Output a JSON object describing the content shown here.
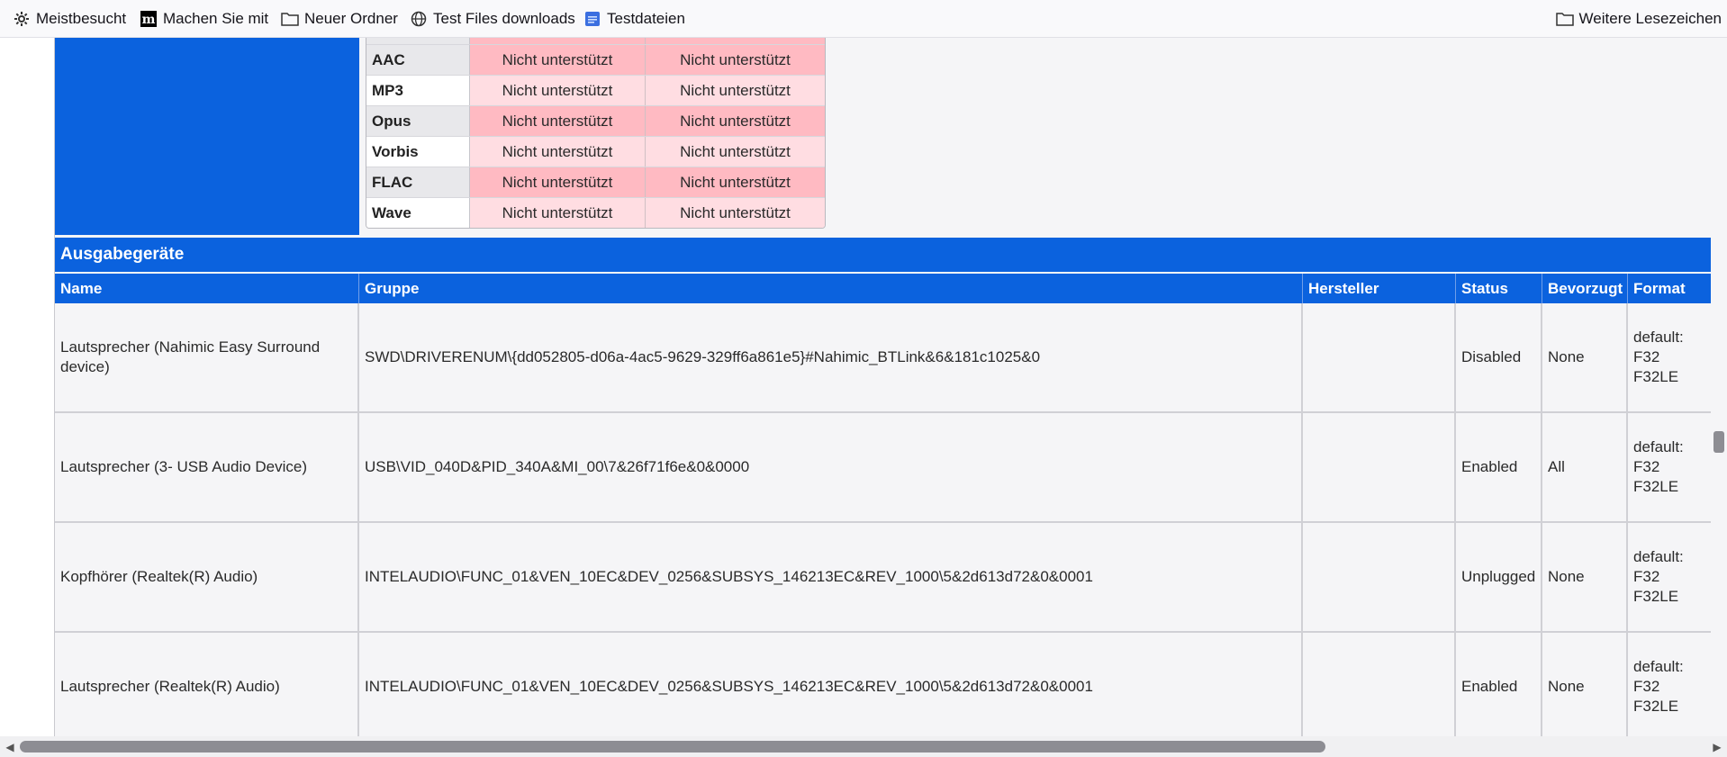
{
  "bookmarks": {
    "items": [
      {
        "label": "Meistbesucht",
        "icon": "gear-icon"
      },
      {
        "label": "Machen Sie mit",
        "icon": "mozilla-m-icon"
      },
      {
        "label": "Neuer Ordner",
        "icon": "folder-icon"
      },
      {
        "label": "Test Files downloads",
        "icon": "globe-icon"
      },
      {
        "label": "Testdateien",
        "icon": "page-icon"
      }
    ],
    "more": {
      "label": "Weitere Lesezeichen",
      "icon": "folder-icon"
    }
  },
  "codecs": {
    "rows": [
      {
        "name": "AAC",
        "v1": "Nicht unterstützt",
        "v2": "Nicht unterstützt"
      },
      {
        "name": "MP3",
        "v1": "Nicht unterstützt",
        "v2": "Nicht unterstützt"
      },
      {
        "name": "Opus",
        "v1": "Nicht unterstützt",
        "v2": "Nicht unterstützt"
      },
      {
        "name": "Vorbis",
        "v1": "Nicht unterstützt",
        "v2": "Nicht unterstützt"
      },
      {
        "name": "FLAC",
        "v1": "Nicht unterstützt",
        "v2": "Nicht unterstützt"
      },
      {
        "name": "Wave",
        "v1": "Nicht unterstützt",
        "v2": "Nicht unterstützt"
      }
    ]
  },
  "output": {
    "title": "Ausgabegeräte",
    "columns": [
      "Name",
      "Gruppe",
      "Hersteller",
      "Status",
      "Bevorzugt",
      "Format"
    ],
    "rows": [
      {
        "name": "Lautsprecher (Nahimic Easy Surround device)",
        "group": "SWD\\DRIVERENUM\\{dd052805-d06a-4ac5-9629-329ff6a861e5}#Nahimic_BTLink&6&181c1025&0",
        "vendor": "",
        "status": "Disabled",
        "preferred": "None",
        "format": "default: F32\nF32LE"
      },
      {
        "name": "Lautsprecher (3- USB Audio Device)",
        "group": "USB\\VID_040D&PID_340A&MI_00\\7&26f71f6e&0&0000",
        "vendor": "",
        "status": "Enabled",
        "preferred": "All",
        "format": "default: F32\nF32LE"
      },
      {
        "name": "Kopfhörer (Realtek(R) Audio)",
        "group": "INTELAUDIO\\FUNC_01&VEN_10EC&DEV_0256&SUBSYS_146213EC&REV_1000\\5&2d613d72&0&0001",
        "vendor": "",
        "status": "Unplugged",
        "preferred": "None",
        "format": "default: F32\nF32LE"
      },
      {
        "name": "Lautsprecher (Realtek(R) Audio)",
        "group": "INTELAUDIO\\FUNC_01&VEN_10EC&DEV_0256&SUBSYS_146213EC&REV_1000\\5&2d613d72&0&0001",
        "vendor": "",
        "status": "Enabled",
        "preferred": "None",
        "format": "default: F32\nF32LE"
      }
    ]
  },
  "colors": {
    "accent_blue": "#0b62de",
    "unsupported_dark": "#ffbac2",
    "unsupported_light": "#ffdde2"
  }
}
